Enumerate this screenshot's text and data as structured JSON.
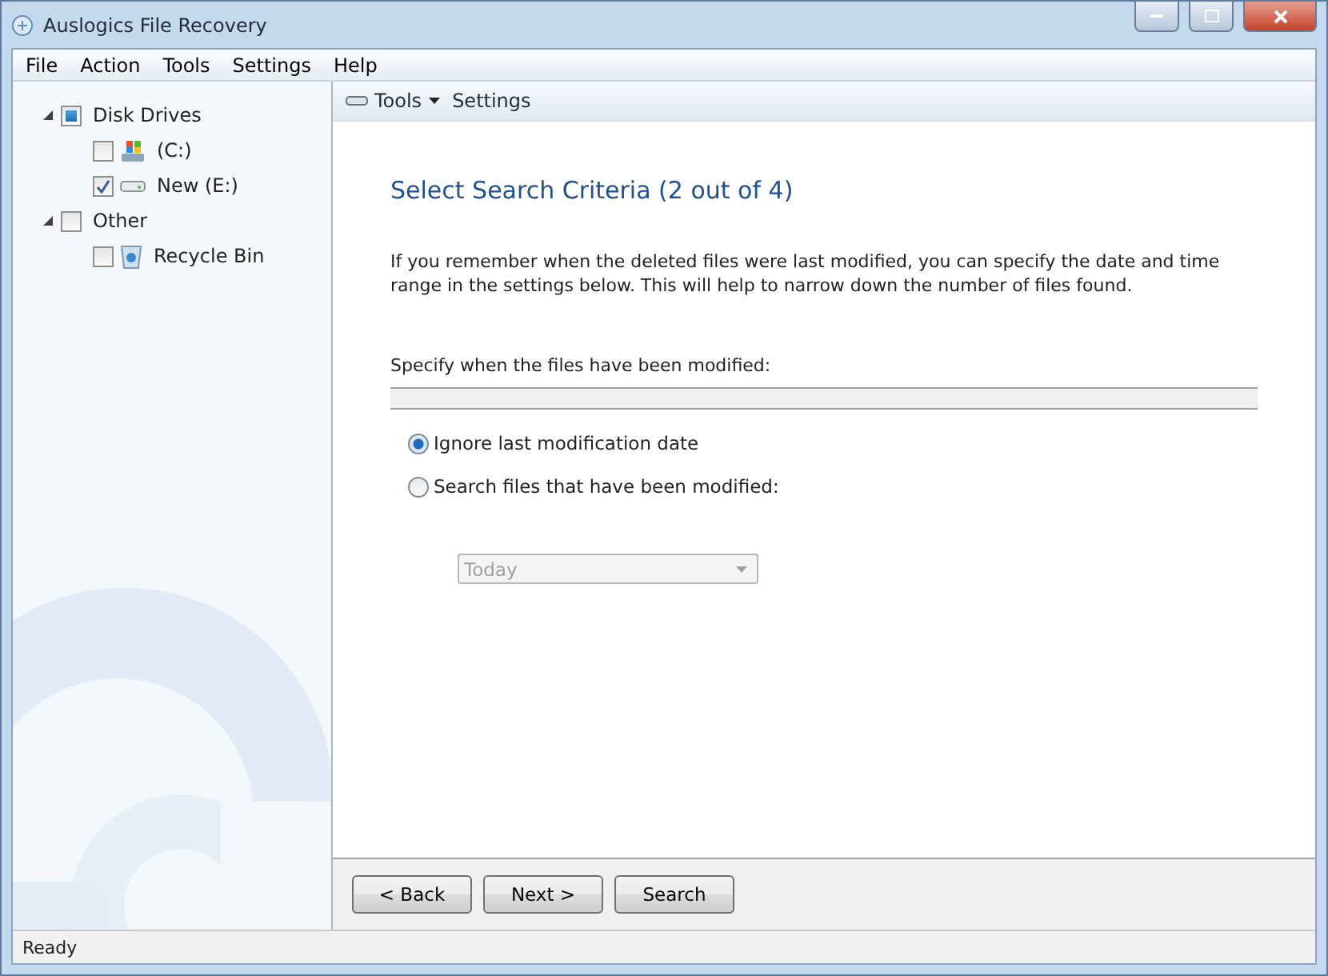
{
  "window": {
    "title": "Auslogics File Recovery"
  },
  "menu": [
    "File",
    "Action",
    "Tools",
    "Settings",
    "Help"
  ],
  "tree": [
    {
      "label": "Disk Drives",
      "expanded": true,
      "checked": false,
      "indeterminate": true,
      "children": [
        {
          "label": "(C:)",
          "kind": "system-drive",
          "checked": false
        },
        {
          "label": "New (E:)",
          "kind": "drive",
          "checked": true
        }
      ]
    },
    {
      "label": "Other",
      "expanded": true,
      "checked": false,
      "indeterminate": false,
      "children": [
        {
          "label": "Recycle Bin",
          "kind": "recycle-bin",
          "checked": false
        }
      ]
    }
  ],
  "toolbar": {
    "tools": "Tools",
    "settings": "Settings"
  },
  "heading": "Select Search Criteria (2 out of 4)",
  "description": "If you remember when the deleted files were last modified, you can specify the date and time range in the settings below. This will help to narrow down the number of files found.",
  "section_label": "Specify when the files have been modified:",
  "options": [
    {
      "label": "Ignore last modification date",
      "selected": true
    },
    {
      "label": "Search files that have been modified:",
      "selected": false
    }
  ],
  "date_select": {
    "value": "Today",
    "disabled": true
  },
  "buttons": [
    "< Back",
    "Next >",
    "Search"
  ],
  "status_bar": "Ready"
}
